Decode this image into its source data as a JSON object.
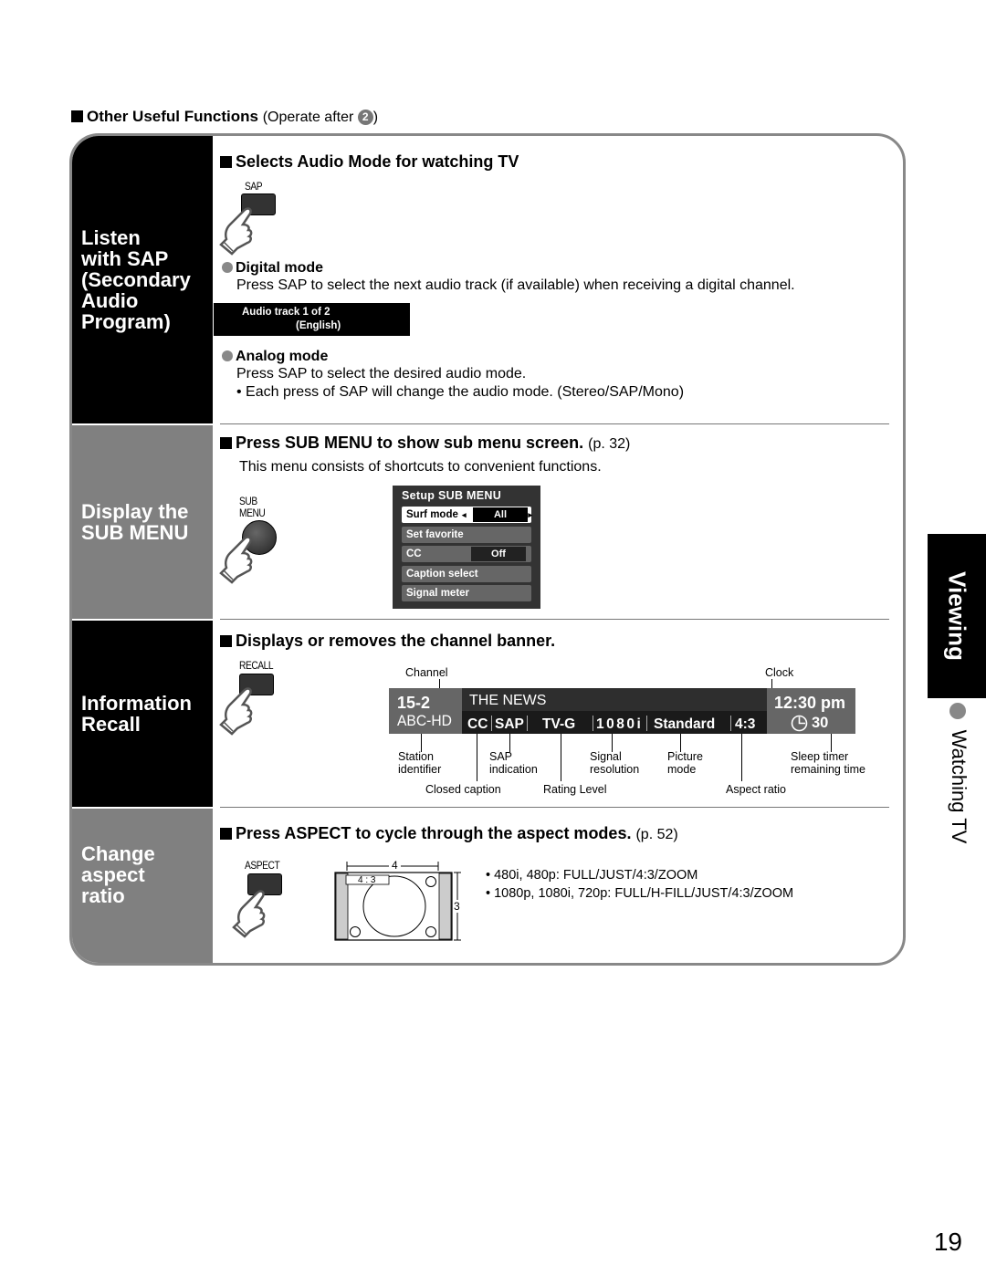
{
  "section": {
    "heading": "Other Useful Functions",
    "note_prefix": "(Operate after ",
    "note_step": "2",
    "note_suffix": ")"
  },
  "side_tab": {
    "category": "Viewing",
    "topic": "Watching TV"
  },
  "page_number": "19",
  "panels": {
    "sap": {
      "side_title_lines": [
        "Listen",
        "with SAP",
        "(Secondary",
        "Audio",
        "Program)"
      ],
      "heading": "Selects Audio Mode for watching TV",
      "button_label": "SAP",
      "digital_title": "Digital mode",
      "digital_text": "Press SAP to select the next audio track (if available) when receiving a digital channel.",
      "osd_line1": "Audio track 1 of 2",
      "osd_line2": "(English)",
      "analog_title": "Analog mode",
      "analog_text": "Press SAP to select the desired audio mode.",
      "analog_bullet": "• Each press of SAP will change the audio mode. (Stereo/SAP/Mono)"
    },
    "submenu": {
      "side_title_lines": [
        "Display the",
        "SUB MENU"
      ],
      "heading": "Press SUB MENU to show sub menu screen.",
      "page_ref": "(p. 32)",
      "description": "This menu consists of shortcuts to convenient functions.",
      "button_label_lines": [
        "SUB",
        "MENU"
      ],
      "osd": {
        "title": "Setup SUB MENU",
        "items": [
          {
            "label": "Surf mode",
            "value": "All",
            "selected": true
          },
          {
            "label": "Set favorite",
            "value": ""
          },
          {
            "label": "CC",
            "value": "Off"
          },
          {
            "label": "Caption select",
            "value": ""
          },
          {
            "label": "Signal meter",
            "value": ""
          }
        ]
      }
    },
    "recall": {
      "side_title_lines": [
        "Information",
        "Recall"
      ],
      "heading": "Displays or removes the channel banner.",
      "button_label": "RECALL",
      "banner": {
        "channel": "15-2",
        "station": "ABC-HD",
        "program": "THE NEWS",
        "cc": "CC",
        "sap": "SAP",
        "rating": "TV-G",
        "resolution": "1080i",
        "picture_mode": "Standard",
        "aspect": "4:3",
        "clock": "12:30 pm",
        "sleep": "30"
      },
      "callouts": {
        "channel": "Channel",
        "clock": "Clock",
        "station": [
          "Station",
          "identifier"
        ],
        "sap": [
          "SAP",
          "indication"
        ],
        "signal": [
          "Signal",
          "resolution"
        ],
        "picture": [
          "Picture",
          "mode"
        ],
        "sleep": [
          "Sleep timer",
          "remaining time"
        ],
        "cc": "Closed caption",
        "rating": "Rating Level",
        "aspect": "Aspect ratio"
      }
    },
    "aspect": {
      "side_title_lines": [
        "Change",
        "aspect",
        "ratio"
      ],
      "heading": "Press ASPECT to cycle through the aspect modes.",
      "page_ref": "(p. 52)",
      "button_label": "ASPECT",
      "diagram": {
        "width_label": "4",
        "height_label": "3",
        "mode_label": "4 : 3"
      },
      "modes": [
        "• 480i, 480p:  FULL/JUST/4:3/ZOOM",
        "• 1080p, 1080i, 720p:  FULL/H-FILL/JUST/4:3/ZOOM"
      ]
    }
  }
}
